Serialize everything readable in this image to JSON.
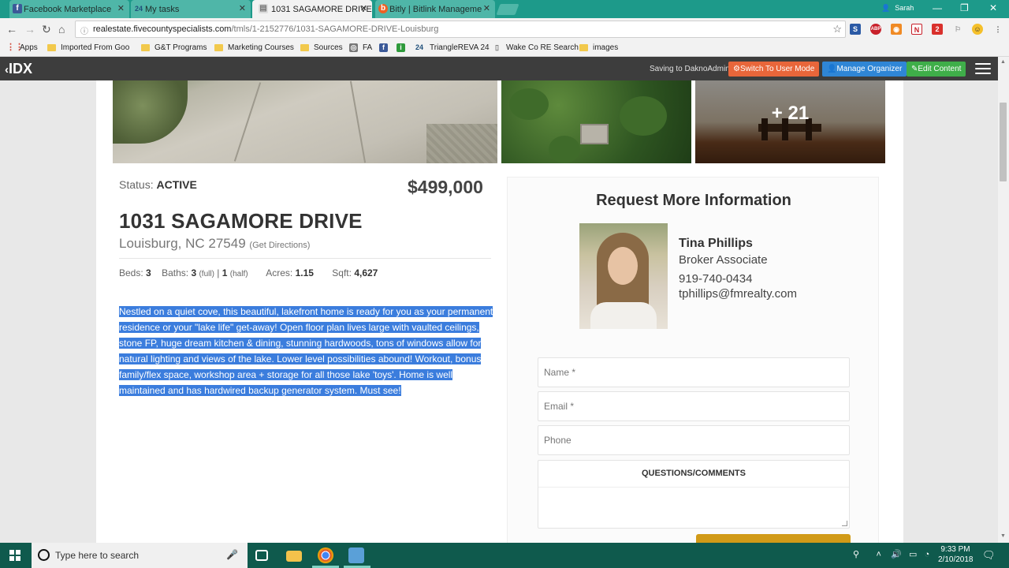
{
  "browser": {
    "tabs": [
      {
        "label": "Facebook Marketplace",
        "icon": "facebook-icon"
      },
      {
        "label": "My tasks",
        "icon": "twentyfour-icon"
      },
      {
        "label": "1031 SAGAMORE DRIVE",
        "icon": "page-icon"
      },
      {
        "label": "Bitly | Bitlink Manageme",
        "icon": "bitly-icon"
      }
    ],
    "profile_name": "Sarah",
    "url_host": "realestate.fivecountyspecialists.com",
    "url_path": "/tmls/1-2152776/1031-SAGAMORE-DRIVE-Louisburg",
    "bookmarks": [
      {
        "label": "Apps"
      },
      {
        "label": "Imported From Goo"
      },
      {
        "label": "G&T Programs"
      },
      {
        "label": "Marketing Courses"
      },
      {
        "label": "Sources"
      },
      {
        "label": "FA"
      },
      {
        "label": ""
      },
      {
        "label": ""
      },
      {
        "label": "TriangleREVA 24"
      },
      {
        "label": "Wake Co RE Search"
      },
      {
        "label": "images"
      }
    ],
    "extensions": [
      "s-ext-icon",
      "adblock-icon",
      "rss-icon",
      "n-ext-icon",
      "badge-ext-icon",
      "feedback-icon",
      "emoji-icon",
      "menu-dots-icon"
    ],
    "badge_count": "2"
  },
  "idx": {
    "logo": "IDX",
    "saving_text": "Saving to DaknoAdmin",
    "switch_label": "Switch To User Mode",
    "organizer_label": "Manage Organizer",
    "edit_label": "Edit Content",
    "colors": {
      "switch": "#e8663a",
      "organizer": "#2f86d6",
      "edit": "#3fae49"
    }
  },
  "gallery": {
    "more_count": "+ 21"
  },
  "listing": {
    "status_label": "Status:",
    "status_value": "ACTIVE",
    "price": "$499,000",
    "address": "1031 SAGAMORE DRIVE",
    "city_line": "Louisburg, NC 27549",
    "directions": "(Get Directions)",
    "beds_label": "Beds:",
    "beds": "3",
    "baths_label": "Baths:",
    "baths_full": "3",
    "baths_full_suffix": "(full)",
    "baths_separator": "|",
    "baths_half": "1",
    "baths_half_suffix": "(half)",
    "acres_label": "Acres:",
    "acres": "1.15",
    "sqft_label": "Sqft:",
    "sqft": "4,627",
    "description": "Nestled on a quiet cove, this beautiful, lakefront home is ready for you as your permanent residence or your \"lake life\" get-away! Open floor plan lives large with vaulted ceilings, stone FP, huge dream kitchen & dining, stunning hardwoods, tons of windows allow for natural lighting and views of the lake. Lower level possibilities abound! Workout, bonus family/flex space, workshop area + storage for all those lake 'toys'. Home is well maintained and has hardwired backup generator system. Must see!"
  },
  "request": {
    "title": "Request More Information",
    "agent_name": "Tina Phillips",
    "agent_role": "Broker Associate",
    "agent_phone": "919-740-0434",
    "agent_email": "tphillips@fmrealty.com",
    "name_placeholder": "Name *",
    "email_placeholder": "Email *",
    "phone_placeholder": "Phone",
    "comments_label": "QUESTIONS/COMMENTS"
  },
  "taskbar": {
    "search_placeholder": "Type here to search",
    "time": "9:33 PM",
    "date": "2/10/2018"
  }
}
